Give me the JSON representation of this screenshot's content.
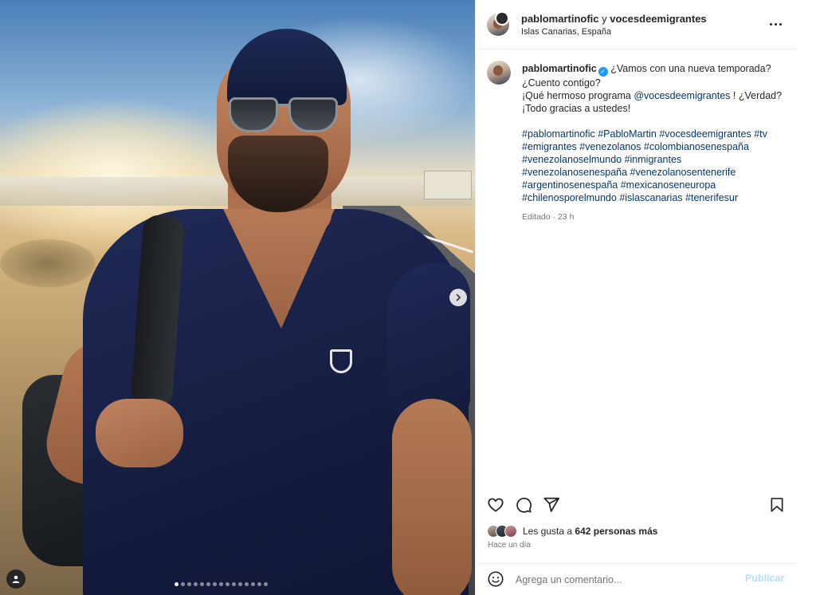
{
  "post": {
    "media": {
      "slide_count": 15,
      "active_slide": 1,
      "next_icon": "chevron-right-icon",
      "tag_icon": "person-icon"
    },
    "header": {
      "author": "pablomartinofic",
      "conjunction": "y",
      "collaborator": "vocesdeemigrantes",
      "location": "Islas Canarias, España",
      "more_icon": "more-horizontal-icon"
    },
    "caption": {
      "username": "pablomartinofic",
      "verified_icon": "verified-badge-icon",
      "line1": "¿Vamos con una nueva temporada? ¿Cuento contigo?",
      "line2_pre": "¡Qué hermoso programa ",
      "mention": "@vocesdeemigrantes",
      "line2_post": " ! ¿Verdad? ¡Todo gracias a ustedes!",
      "hashtags": [
        "#pablomartinofic",
        "#PabloMartin",
        "#vocesdeemigrantes",
        "#tv",
        "#emigrantes",
        "#venezolanos",
        "#colombianosenespaña",
        "#venezolanoselmundo",
        "#inmigrantes",
        "#venezolanosenespaña",
        "#venezolanosentenerife",
        "#argentinosenespaña",
        "#mexicanoseneuropa",
        "#chilenosporelmundo",
        "#islascanarias",
        "#tenerifesur"
      ],
      "edited": "Editado",
      "separator": "·",
      "time": "23 h"
    },
    "actions": {
      "like_icon": "heart-icon",
      "comment_icon": "comment-icon",
      "share_icon": "send-icon",
      "save_icon": "bookmark-icon"
    },
    "likes": {
      "prefix": "Les gusta a ",
      "count_text": "642 personas más"
    },
    "time_ago": "Hace un día",
    "comment": {
      "emoji_icon": "emoji-icon",
      "placeholder": "Agrega un comentario...",
      "publish_label": "Publicar"
    }
  },
  "colors": {
    "link": "#00376b",
    "verified": "#1d9bf0",
    "publish_disabled": "#b2dffc",
    "secondary_text": "#737373"
  }
}
